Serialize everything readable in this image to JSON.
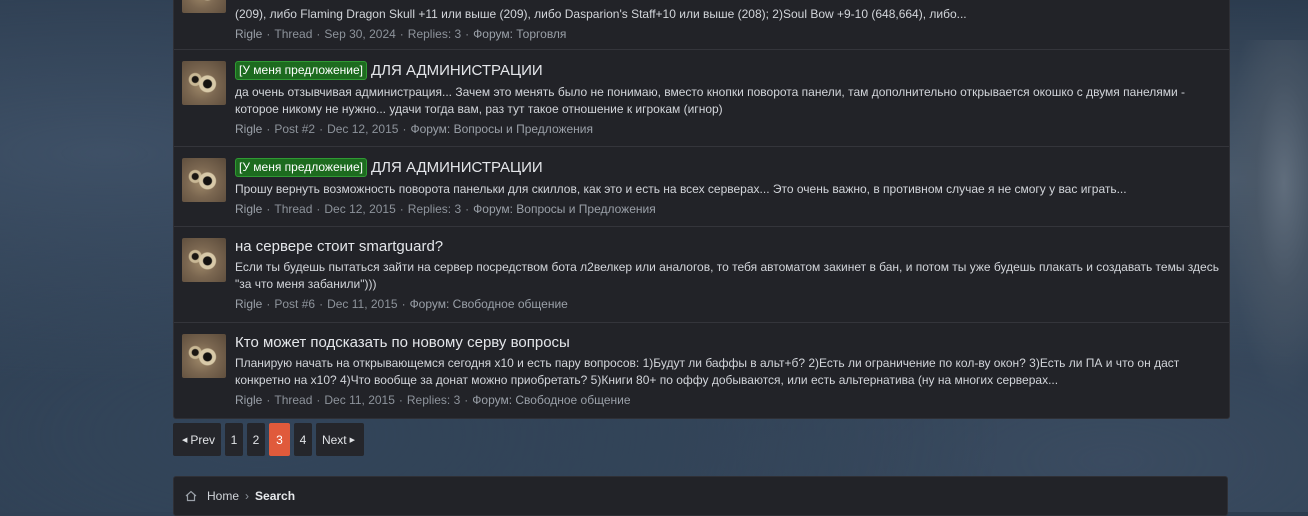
{
  "results": [
    {
      "prefix": "",
      "title": "",
      "snippet": "(209), либо Flaming Dragon Skull +11 или выше (209), либо Dasparion's Staff+10 или выше (208); 2)Soul Bow +9-10 (648,664), либо...",
      "meta": {
        "author": "Rigle",
        "type": "Thread",
        "date": "Sep 30, 2024",
        "extra": "Replies: 3",
        "forum": "Форум: Торговля"
      }
    },
    {
      "prefix": "[У меня предложение]",
      "title": "ДЛЯ АДМИНИСТРАЦИИ",
      "snippet": "да очень отзывчивая администрация... Зачем это менять было не понимаю, вместо кнопки поворота панели, там дополнительно открывается окошко с двумя панелями - которое никому не нужно... удачи тогда вам, раз тут такое отношение к игрокам (игнор)",
      "meta": {
        "author": "Rigle",
        "type": "Post #2",
        "date": "Dec 12, 2015",
        "extra": "",
        "forum": "Форум: Вопросы и Предложения"
      }
    },
    {
      "prefix": "[У меня предложение]",
      "title": "ДЛЯ АДМИНИСТРАЦИИ",
      "snippet": "Прошу вернуть возможность поворота панельки для скиллов, как это и есть на всех серверах... Это очень важно, в противном случае я не смогу у вас играть...",
      "meta": {
        "author": "Rigle",
        "type": "Thread",
        "date": "Dec 12, 2015",
        "extra": "Replies: 3",
        "forum": "Форум: Вопросы и Предложения"
      }
    },
    {
      "prefix": "",
      "title": "на сервере стоит smartguard?",
      "snippet": "Если ты будешь пытаться зайти на сервер посредством бота л2велкер или аналогов, то тебя автоматом закинет в бан, и потом ты уже будешь плакать и создавать темы здесь \"за что меня забанили\")))",
      "meta": {
        "author": "Rigle",
        "type": "Post #6",
        "date": "Dec 11, 2015",
        "extra": "",
        "forum": "Форум: Свободное общение"
      }
    },
    {
      "prefix": "",
      "title": "Кто может подсказать по новому серву вопросы",
      "snippet": "Планирую начать на открывающемся сегодня x10 и есть пару вопросов: 1)Будут ли баффы в альт+б? 2)Есть ли ограничение по кол-ву окон? 3)Есть ли ПА и что он даст конкретно на x10? 4)Что вообще за донат можно приобретать? 5)Книги 80+ по оффу добываются, или есть альтернатива (ну на многих серверах...",
      "meta": {
        "author": "Rigle",
        "type": "Thread",
        "date": "Dec 11, 2015",
        "extra": "Replies: 3",
        "forum": "Форум: Свободное общение"
      }
    }
  ],
  "pagination": {
    "prev": "Prev",
    "next": "Next",
    "pages": [
      "1",
      "2",
      "3",
      "4"
    ],
    "current": "3"
  },
  "breadcrumb": {
    "home": "Home",
    "current": "Search"
  },
  "colors": {
    "prefix_bg": "#1d6b1f",
    "active_page": "#e05a3b"
  },
  "icons": {
    "page_caret_left": "caret-left-icon",
    "page_caret_right": "caret-right-icon",
    "home": "home-icon",
    "avatar": "cat-avatar-image"
  }
}
